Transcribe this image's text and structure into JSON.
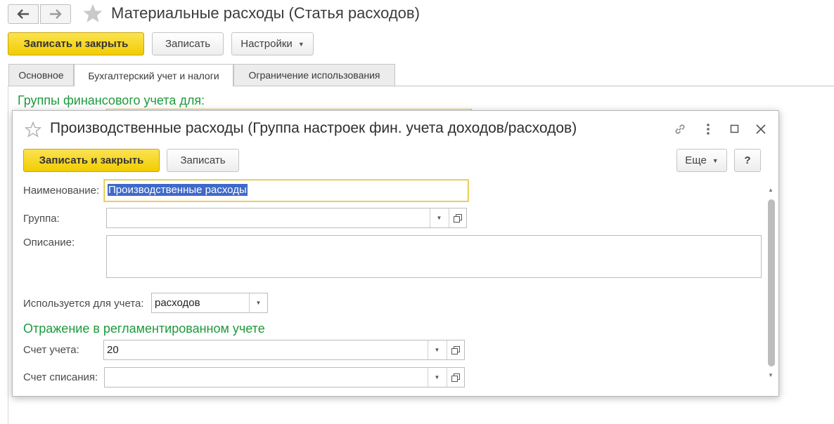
{
  "main": {
    "title": "Материальные расходы (Статья расходов)",
    "nav": {
      "back_icon": "arrow-left-icon",
      "forward_icon": "arrow-right-icon"
    },
    "favorite_icon": "star-icon",
    "toolbar": {
      "save_close": "Записать и закрыть",
      "save": "Записать",
      "settings": "Настройки"
    },
    "tabs": [
      {
        "label": "Основное",
        "active": false
      },
      {
        "label": "Бухгалтерский учет и налоги",
        "active": true
      },
      {
        "label": "Ограничение использования",
        "active": false
      }
    ],
    "section_title": "Группы финансового учета для:"
  },
  "dialog": {
    "title": "Производственные расходы (Группа настроек фин. учета доходов/расходов)",
    "header_icons": [
      "star-icon",
      "link-icon",
      "more-icon",
      "maximize-icon",
      "close-icon"
    ],
    "toolbar": {
      "save_close": "Записать и закрыть",
      "save": "Записать",
      "more": "Еще",
      "help": "?"
    },
    "fields": {
      "name_label": "Наименование:",
      "name_value": "Производственные расходы",
      "group_label": "Группа:",
      "group_value": "",
      "description_label": "Описание:",
      "description_value": "",
      "used_for_label": "Используется для учета:",
      "used_for_value": "расходов"
    },
    "section_title": "Отражение в регламентированном учете",
    "accounting": {
      "account_label": "Счет учета:",
      "account_value": "20",
      "writeoff_label": "Счет списания:",
      "writeoff_value": ""
    }
  },
  "colors": {
    "accent_yellow": "#f2cc00",
    "section_green": "#1d9a3c",
    "selection_blue": "#3f69c9"
  }
}
